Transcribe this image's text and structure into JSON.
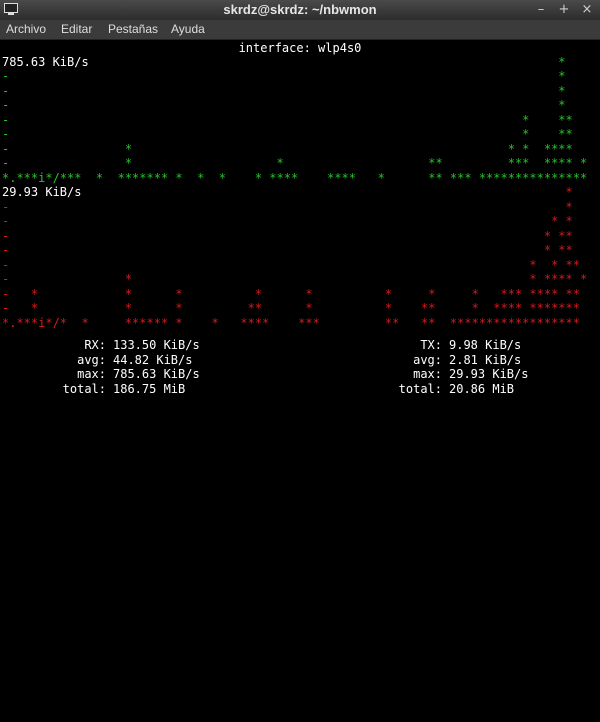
{
  "window": {
    "title": "skrdz@skrdz: ~/nbwmon",
    "buttons": {
      "minimize": "–",
      "maximize": "+",
      "close": "×"
    }
  },
  "menu": {
    "items": [
      "Archivo",
      "Editar",
      "Pestañas",
      "Ayuda"
    ]
  },
  "terminal": {
    "interface_label": "interface: wlp4s0",
    "rx_graph": {
      "peak_label": "785.63 KiB/s",
      "rows": [
        "                                                                             *",
        "-                                                                            *",
        "-                                                                            *",
        "-                                                                            *",
        "-                                                                       *    **",
        "-                                                                       *    **",
        "-                *                                                    * *  ****",
        "-                *                    *                    **         ***  **** *",
        "*.***i*/***  *  ******* *  *  *    * ****    ****   *      ** *** ***************"
      ]
    },
    "tx_graph": {
      "peak_label": "29.93 KiB/s",
      "rows": [
        "                                                                              *",
        "-                                                                             *",
        "-                                                                           * *",
        "-                                                                          * **",
        "-                                                                          * **",
        "-                                                                        *  * **",
        "-                *                                                       * **** *",
        "-   *            *      *          *      *          *     *     *   *** **** **",
        "-   *            *      *         **      *          *    **     *  **** *******",
        "*.***i*/*  *     ****** *    *   ****    ***         **   **  ******************"
      ]
    },
    "rx_stats": {
      "current_label": "RX:",
      "current_value": "133.50 KiB/s",
      "avg_label": "avg:",
      "avg_value": "44.82 KiB/s",
      "max_label": "max:",
      "max_value": "785.63 KiB/s",
      "total_label": "total:",
      "total_value": "186.75 MiB"
    },
    "tx_stats": {
      "current_label": "TX:",
      "current_value": "9.98 KiB/s",
      "avg_label": "avg:",
      "avg_value": "2.81 KiB/s",
      "max_label": "max:",
      "max_value": "29.93 KiB/s",
      "total_label": "total:",
      "total_value": "20.86 MiB"
    }
  }
}
